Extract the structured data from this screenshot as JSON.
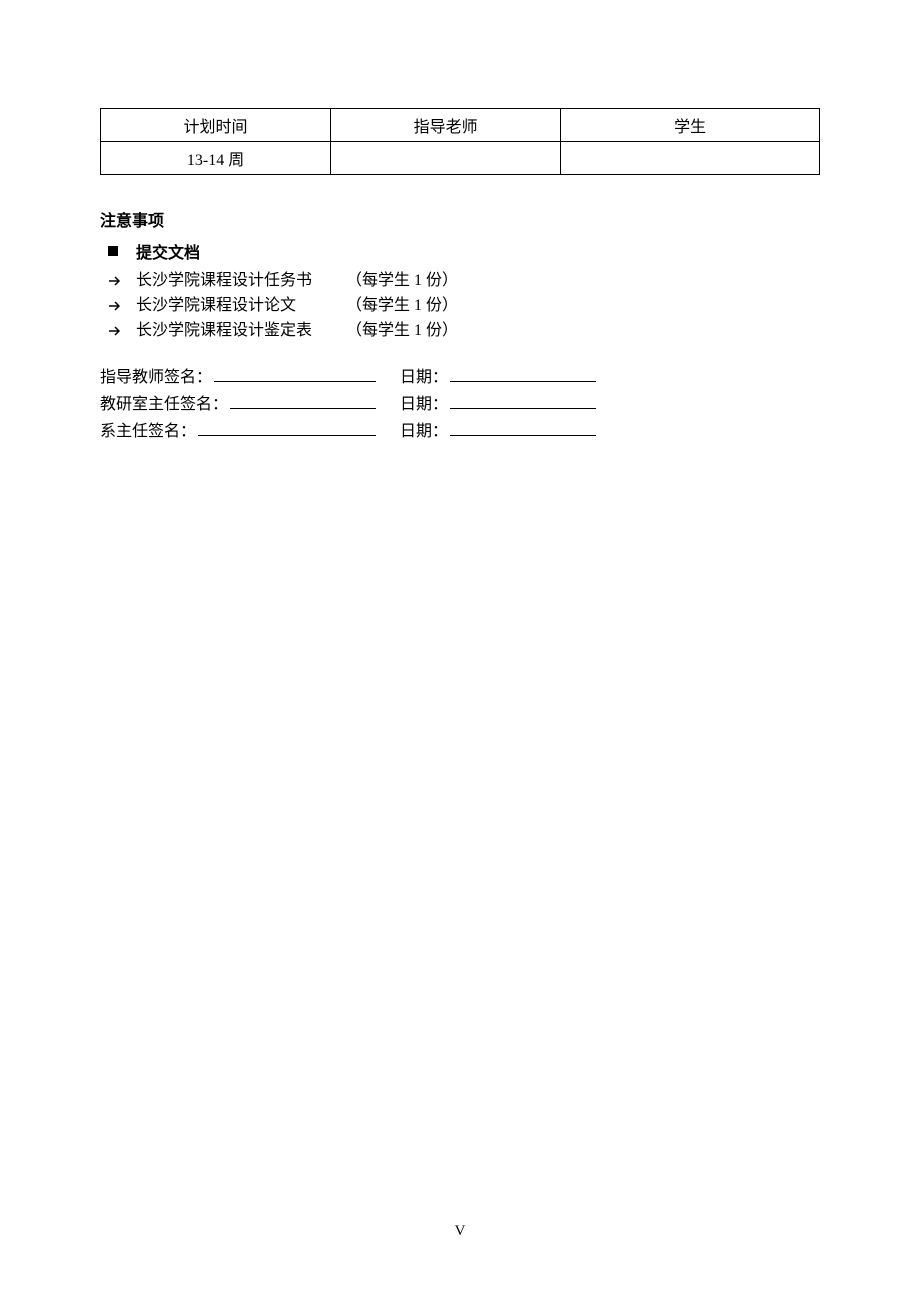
{
  "table": {
    "headers": [
      "计划时间",
      "指导老师",
      "学生"
    ],
    "rows": [
      {
        "col1": "13-14 周",
        "col2": "",
        "col3": ""
      }
    ]
  },
  "notes_heading": "注意事项",
  "submit_heading": "提交文档",
  "docs": [
    {
      "title": "长沙学院课程设计任务书",
      "note": "（每学生 1 份）"
    },
    {
      "title": "长沙学院课程设计论文",
      "note": "（每学生 1 份）"
    },
    {
      "title": "长沙学院课程设计鉴定表",
      "note": "（每学生 1 份）"
    }
  ],
  "signatures": [
    {
      "label": "指导教师签名：",
      "date_label": "日期："
    },
    {
      "label": "教研室主任签名：",
      "date_label": "日期："
    },
    {
      "label": "系主任签名：",
      "date_label": "日期："
    }
  ],
  "page_number": "V"
}
